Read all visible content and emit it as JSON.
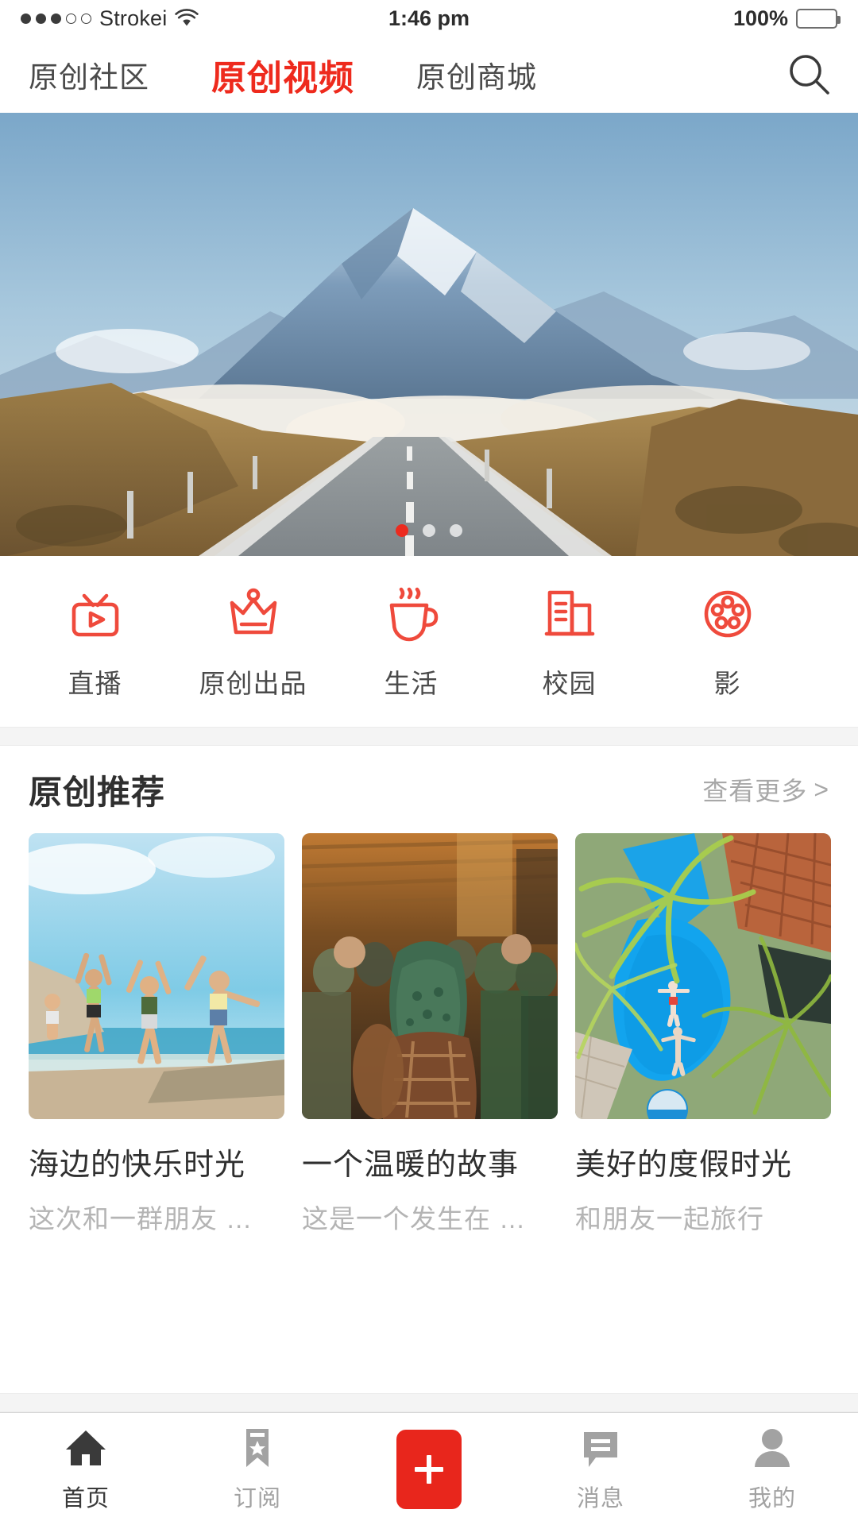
{
  "status_bar": {
    "signal_dots_filled": 3,
    "signal_dots_total": 5,
    "carrier": "Strokei",
    "wifi_icon": "wifi-icon",
    "time": "1:46 pm",
    "battery_percent": "100%",
    "battery_icon": "battery-full-icon"
  },
  "top_nav": {
    "tabs": [
      {
        "label": "原创社区",
        "active": false
      },
      {
        "label": "原创视频",
        "active": true
      },
      {
        "label": "原创商城",
        "active": false
      }
    ],
    "search_icon": "search-icon",
    "accent_color": "#ee2a1d"
  },
  "carousel": {
    "description": "mountain road landscape",
    "slide_count": 3,
    "active_slide": 1,
    "active_dot_color": "#ec2b1f"
  },
  "categories": [
    {
      "label": "直播",
      "icon": "live-tv-icon"
    },
    {
      "label": "原创出品",
      "icon": "crown-icon"
    },
    {
      "label": "生活",
      "icon": "coffee-cup-icon"
    },
    {
      "label": "校园",
      "icon": "buildings-icon"
    },
    {
      "label": "影",
      "icon": "film-reel-icon"
    }
  ],
  "recommend": {
    "title": "原创推荐",
    "more_label": "查看更多",
    "more_chevron": ">",
    "cards": [
      {
        "title": "海边的快乐时光",
        "desc": "这次和一群朋友 …",
        "image": "friends-jumping-beach"
      },
      {
        "title": "一个温暖的故事",
        "desc": "这是一个发生在 …",
        "image": "crowded-market-street"
      },
      {
        "title": "美好的度假时光",
        "desc": "和朋友一起旅行",
        "image": "aerial-pool-palms"
      }
    ]
  },
  "tab_bar": {
    "items": [
      {
        "label": "首页",
        "icon": "home-icon",
        "active": true
      },
      {
        "label": "订阅",
        "icon": "bookmark-star-icon",
        "active": false
      },
      {
        "label": "",
        "icon": "plus-icon",
        "active": false,
        "is_action": true
      },
      {
        "label": "消息",
        "icon": "message-icon",
        "active": false
      },
      {
        "label": "我的",
        "icon": "person-icon",
        "active": false
      }
    ],
    "action_color": "#e8261c"
  }
}
